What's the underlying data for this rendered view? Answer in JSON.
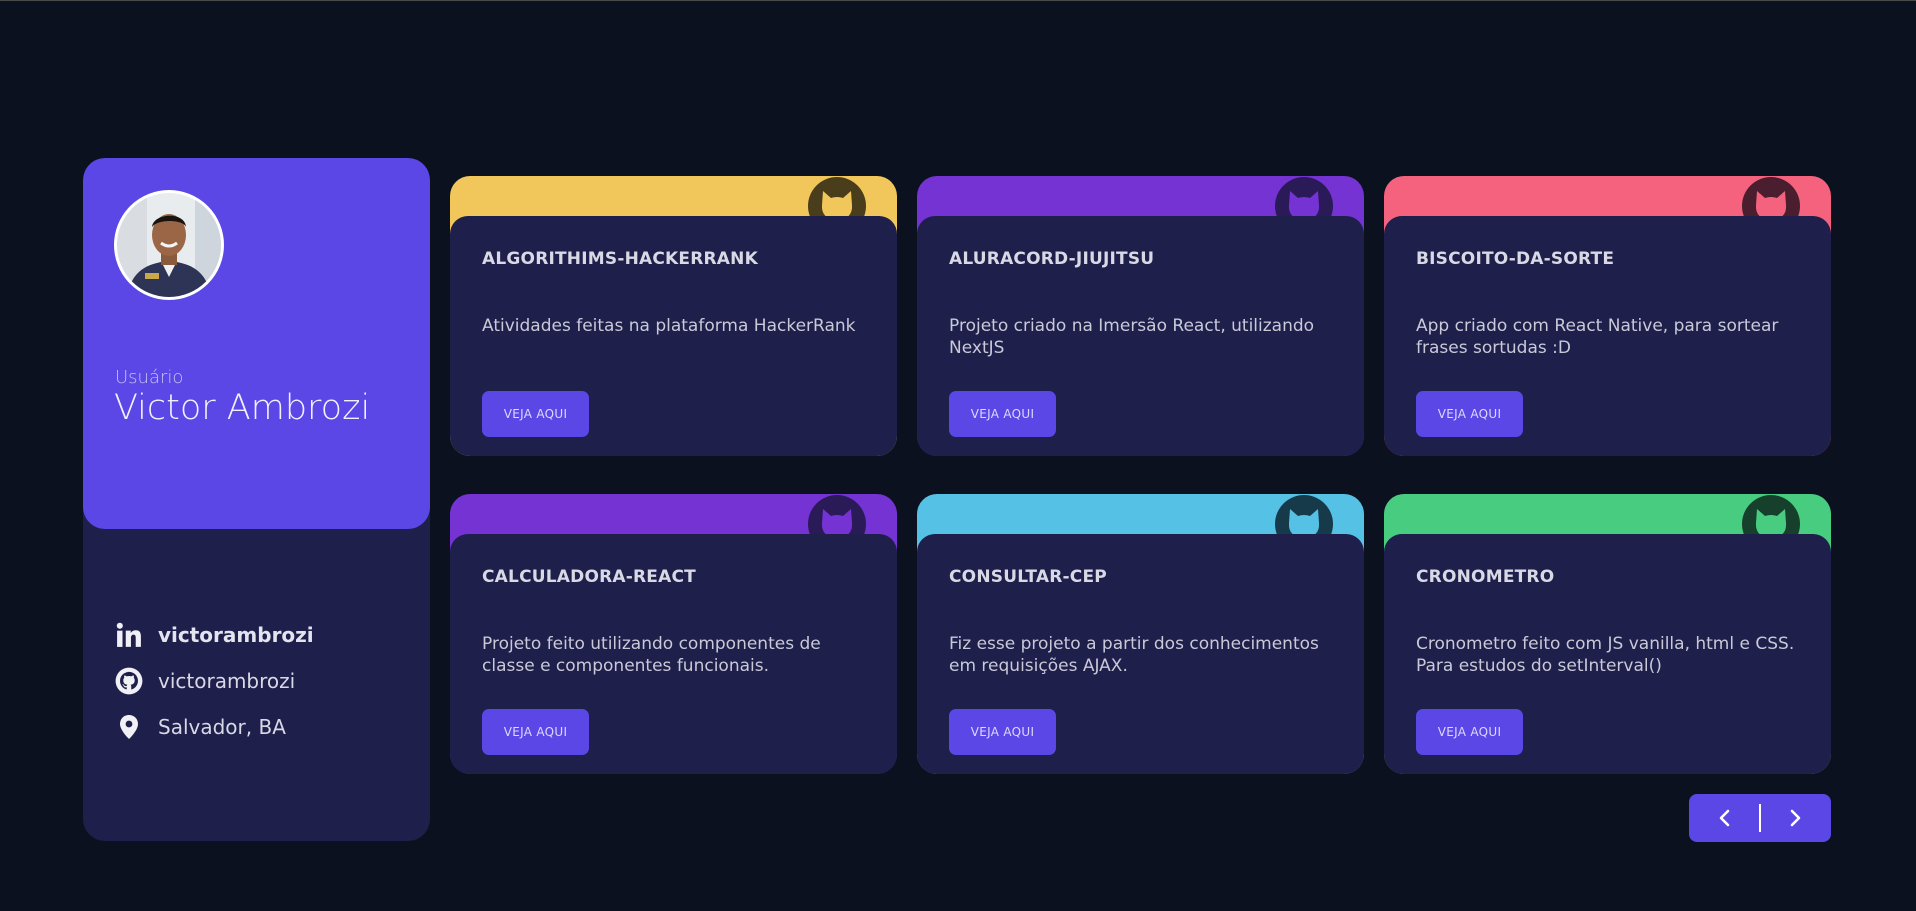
{
  "profile": {
    "label": "Usuário",
    "name": "Victor Ambrozi",
    "linkedin": "victorambrozi",
    "github": "victorambrozi",
    "location": "Salvador, BA"
  },
  "repos": [
    {
      "title": "ALGORITHIMS-HACKERRANK",
      "description": "Atividades feitas na plataforma HackerRank",
      "button": "VEJA AQUI",
      "color": "#f1c65a",
      "badge_color": "#4a3d1c"
    },
    {
      "title": "ALURACORD-JIUJITSU",
      "description": "Projeto criado na Imersão React, utilizando NextJS",
      "button": "VEJA AQUI",
      "color": "#7433d2",
      "badge_color": "#2b1a58"
    },
    {
      "title": "BISCOITO-DA-SORTE",
      "description": "App criado com React Native, para sortear frases sortudas :D",
      "button": "VEJA AQUI",
      "color": "#f5627e",
      "badge_color": "#4a1e2e"
    },
    {
      "title": "CALCULADORA-REACT",
      "description": "Projeto feito utilizando componentes de classe e componentes funcionais.",
      "button": "VEJA AQUI",
      "color": "#7433d2",
      "badge_color": "#2b1a58"
    },
    {
      "title": "CONSULTAR-CEP",
      "description": "Fiz esse projeto a partir dos conhecimentos em requisições AJAX.",
      "button": "VEJA AQUI",
      "color": "#55c1e5",
      "badge_color": "#173a4b"
    },
    {
      "title": "CRONOMETRO",
      "description": "Cronometro feito com JS vanilla, html e CSS. Para estudos do setInterval()",
      "button": "VEJA AQUI",
      "color": "#48cd80",
      "badge_color": "#17402c"
    }
  ],
  "colors": {
    "accent": "#5a47e6",
    "card_body": "#1e1f4b",
    "background": "#0c1120"
  }
}
